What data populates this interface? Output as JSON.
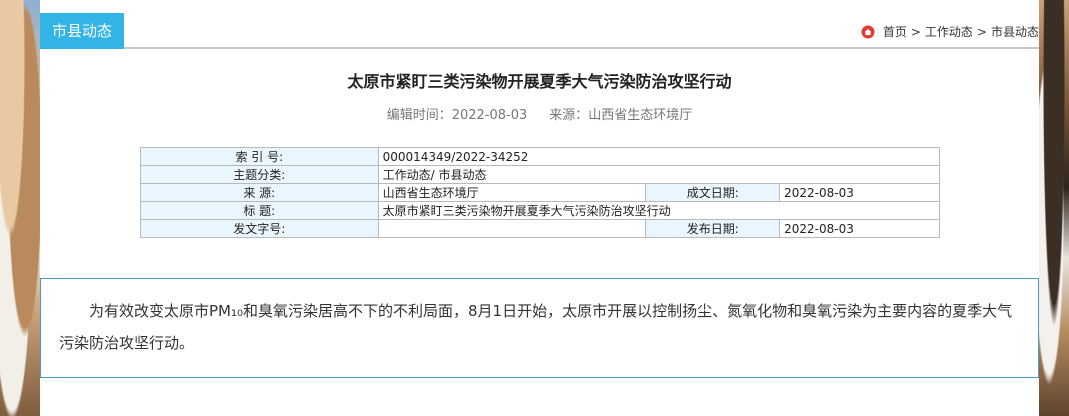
{
  "section": {
    "tab_label": "市县动态"
  },
  "breadcrumb": {
    "home_label": "首页",
    "sep": ">",
    "level1": "工作动态",
    "level2": "市县动态",
    "home_icon": "home-icon",
    "home_icon_color": "#e53935"
  },
  "article": {
    "title": "太原市紧盯三类污染物开展夏季大气污染防治攻坚行动",
    "edit_time_label": "编辑时间：",
    "edit_time": "2022-08-03",
    "source_label": "来源：",
    "source": "山西省生态环境厅",
    "body": "为有效改变太原市PM₁₀和臭氧污染居高不下的不利局面，8月1日开始，太原市开展以控制扬尘、氮氧化物和臭氧污染为主要内容的夏季大气污染防治攻坚行动。"
  },
  "info_table": {
    "index_label": "索 引 号:",
    "index_value": "000014349/2022-34252",
    "category_label": "主题分类:",
    "category_value": "工作动态/ 市县动态",
    "source_label": "来      源:",
    "source_value": "山西省生态环境厅",
    "created_label": "成文日期:",
    "created_value": "2022-08-03",
    "title_label": "标      题:",
    "title_value": "太原市紧盯三类污染物开展夏季大气污染防治攻坚行动",
    "doc_no_label": "发文字号:",
    "doc_no_value": "",
    "published_label": "发布日期:",
    "published_value": "2022-08-03"
  },
  "colors": {
    "accent": "#33b4e6",
    "table_label_bg": "#eaf6fd",
    "content_border": "#4a9dc9"
  }
}
